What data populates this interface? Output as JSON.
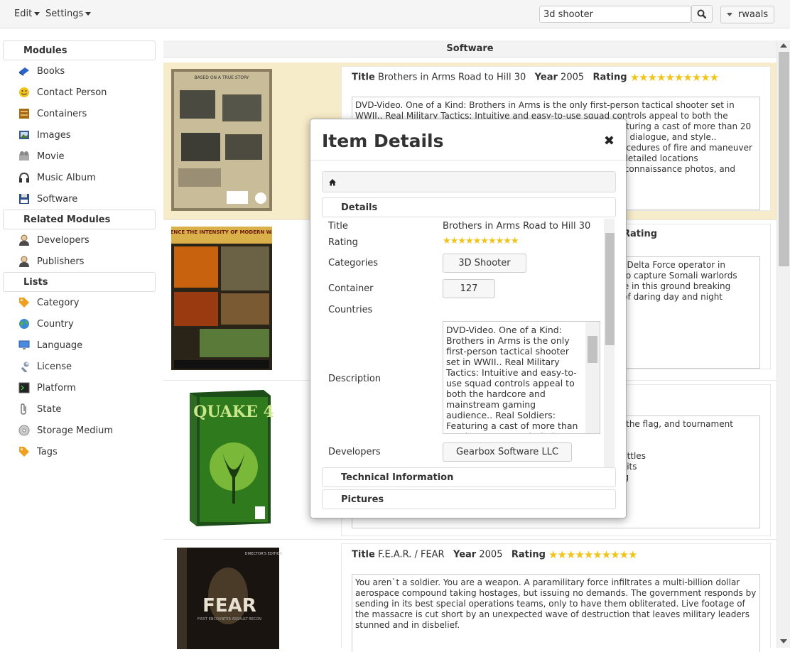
{
  "topbar": {
    "edit_label": "Edit",
    "settings_label": "Settings",
    "search_value": "3d shooter",
    "user_label": "rwaals"
  },
  "sidebar": {
    "modules_title": "Modules",
    "modules": [
      {
        "label": "Books",
        "icon": "book-icon"
      },
      {
        "label": "Contact Person",
        "icon": "smiley-icon"
      },
      {
        "label": "Containers",
        "icon": "container-icon"
      },
      {
        "label": "Images",
        "icon": "image-icon"
      },
      {
        "label": "Movie",
        "icon": "movie-icon"
      },
      {
        "label": "Music Album",
        "icon": "headphones-icon"
      },
      {
        "label": "Software",
        "icon": "floppy-icon"
      }
    ],
    "related_title": "Related Modules",
    "related": [
      {
        "label": "Developers",
        "icon": "person-icon"
      },
      {
        "label": "Publishers",
        "icon": "person-icon"
      }
    ],
    "lists_title": "Lists",
    "lists": [
      {
        "label": "Category",
        "icon": "tag-icon"
      },
      {
        "label": "Country",
        "icon": "globe-icon"
      },
      {
        "label": "Language",
        "icon": "monitor-icon"
      },
      {
        "label": "License",
        "icon": "wrench-icon"
      },
      {
        "label": "Platform",
        "icon": "terminal-icon"
      },
      {
        "label": "State",
        "icon": "paperclip-icon"
      },
      {
        "label": "Storage Medium",
        "icon": "disc-icon"
      },
      {
        "label": "Tags",
        "icon": "tag-icon"
      }
    ]
  },
  "main": {
    "title": "Software",
    "items": [
      {
        "title_label": "Title",
        "title": "Brothers in Arms Road to Hill 30",
        "year_label": "Year",
        "year": "2005",
        "rating_label": "Rating",
        "rating": 10,
        "description": "DVD-Video. One of a Kind: Brothers in Arms is the only first-person tactical shooter set in WWII.. Real Military Tactics: Intuitive and easy-to-use squad controls appeal to both the hardcore and mainstream gaming audience.. Real Soldiers: Featuring a cast of more than 20 characters, each tied to their real-life counterparts' personality, dialogue, and style.. Revolutionary suppression system accurately simulates the procedures of fire and maneuver to suppress and destroy the enemy.. Historically accurate and detailed locations reconstructed from US Army and Signal Corps photos, Aerial reconnaissance photos, and eyewitness accounts."
      },
      {
        "rating_label": "Rating",
        "description": "Delta Force: Black Hawk Down puts you in the boots of an elite Delta Force operator in Mogadishu Somalia. In 1993, US special forces were deployed to capture Somali warlords and restore order. You will play a role in Operation Restore Hope in this ground breaking shooter. Take control of the hot zone and operate in a number of daring day and night operations in and around Mogadishu.\n\n- Use real weapons of the era: snipe\n- Engage enemies at close and long range\n- Operate as a gunner on helicopters or Humvees"
      },
      {
        "description": "Multiplayer: Play as a Strogg or Marine in deathmatch, capture the flag, and tournament modes.\n1) Fight in chaotic battles alongside a squad\n2) Experience epic campaign missions along with large, epic battles\n3) Drive a variety of vehicles, along with mechanized walker units\n4) Fight as a Marine, then after your capture become the Strogg\n6) Utilize hi-tech weaponry with upgradeable modifications"
      },
      {
        "title_label": "Title",
        "title": "F.E.A.R. / FEAR",
        "year_label": "Year",
        "year": "2005",
        "rating_label": "Rating",
        "rating": 10,
        "description": "You aren`t a soldier. You are a weapon. A paramilitary force infiltrates a multi-billion dollar aerospace compound taking hostages, but issuing no demands. The government responds by sending in its best special operations teams, only to have them obliterated. Live footage of the massacre is cut short by an unexpected wave of destruction that leaves military leaders stunned and in disbelief."
      }
    ],
    "covers": [
      {
        "top_text": "BASED ON A TRUE STORY"
      },
      {
        "top_text": "EXPERIENCE THE INTENSITY OF MODERN WARFARE"
      },
      {
        "top_text": "QUAKE 4"
      },
      {
        "top_text": "FEAR",
        "tag": "DIRECTOR'S EDITION",
        "sub": "FIRST ENCOUNTER ASSAULT RECON"
      }
    ]
  },
  "modal": {
    "title": "Item Details",
    "details_header": "Details",
    "fields": {
      "title_label": "Title",
      "title_value": "Brothers in Arms Road to Hill 30",
      "rating_label": "Rating",
      "rating": 10,
      "categories_label": "Categories",
      "category": "3D Shooter",
      "container_label": "Container",
      "container": "127",
      "countries_label": "Countries",
      "description_label": "Description",
      "description": "DVD-Video. One of a Kind: Brothers in Arms is the only first-person tactical shooter set in WWII.. Real Military Tactics: Intuitive and easy-to-use squad controls appeal to both the hardcore and mainstream gaming audience.. Real Soldiers: Featuring a cast of more than 20 characters, each tied to their real-life counterparts.",
      "developers_label": "Developers",
      "developer": "Gearbox Software LLC"
    },
    "technical_header": "Technical Information",
    "pictures_header": "Pictures"
  }
}
